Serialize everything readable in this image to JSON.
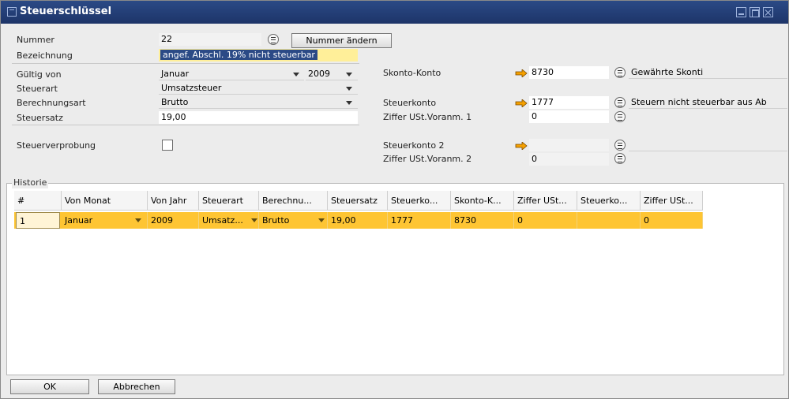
{
  "window": {
    "title": "Steuerschlüssel"
  },
  "left": {
    "nummer": {
      "label": "Nummer",
      "value": "22",
      "change_button": "Nummer ändern"
    },
    "bezeichnung": {
      "label": "Bezeichnung",
      "value": "angef. Abschl. 19% nicht steuerbar"
    },
    "gueltig_von": {
      "label": "Gültig von",
      "month": "Januar",
      "year": "2009"
    },
    "steuerart": {
      "label": "Steuerart",
      "value": "Umsatzsteuer"
    },
    "berechnungsart": {
      "label": "Berechnungsart",
      "value": "Brutto"
    },
    "steuersatz": {
      "label": "Steuersatz",
      "value": "19,00"
    },
    "steuerverprobung": {
      "label": "Steuerverprobung",
      "checked": false
    }
  },
  "right": {
    "skonto_konto": {
      "label": "Skonto-Konto",
      "value": "8730",
      "name": "Gewährte Skonti"
    },
    "steuerkonto": {
      "label": "Steuerkonto",
      "value": "1777",
      "name": "Steuern nicht steuerbar aus Ab"
    },
    "ziffer1": {
      "label": "Ziffer USt.Voranm. 1",
      "value": "0"
    },
    "steuerkonto2": {
      "label": "Steuerkonto 2",
      "value": "",
      "name": ""
    },
    "ziffer2": {
      "label": "Ziffer USt.Voranm. 2",
      "value": "0"
    }
  },
  "historie": {
    "label": "Historie",
    "columns": [
      "#",
      "Von Monat",
      "Von Jahr",
      "Steuerart",
      "Berechnu...",
      "Steuersatz",
      "Steuerko...",
      "Skonto-K...",
      "Ziffer USt...",
      "Steuerko...",
      "Ziffer USt..."
    ],
    "rows": [
      [
        "1",
        "Januar",
        "2009",
        "Umsatz...",
        "Brutto",
        "19,00",
        "1777",
        "8730",
        "0",
        "",
        "0"
      ]
    ]
  },
  "footer": {
    "ok_label": "OK",
    "cancel_label": "Abbrechen"
  },
  "colors": {
    "titlebar": "#1d3468",
    "selected_row": "#fec533",
    "highlight_field": "#ffef99",
    "arrow": "#f5a000"
  }
}
